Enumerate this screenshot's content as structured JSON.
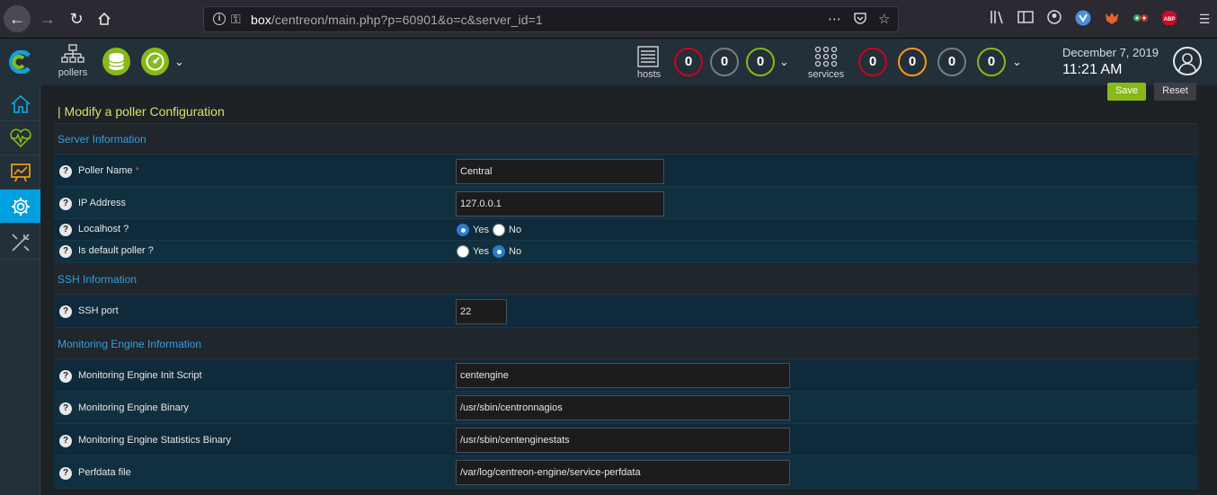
{
  "browser": {
    "url_host": "box",
    "url_path": "/centreon/main.php?p=60901&o=c&server_id=1"
  },
  "header": {
    "pollers_label": "pollers",
    "hosts_label": "hosts",
    "services_label": "services",
    "host_counts": [
      "0",
      "0",
      "0"
    ],
    "service_counts": [
      "0",
      "0",
      "0",
      "0"
    ],
    "date": "December 7, 2019",
    "time": "11:21 AM",
    "colors": {
      "critical": "#d0021b",
      "unreachable": "#7c7c7c",
      "ok": "#88b917",
      "warning": "#ff9913",
      "accent": "#009fdf"
    }
  },
  "toolbar": {
    "save_label": "Save",
    "reset_label": "Reset"
  },
  "page": {
    "title": "| Modify a poller Configuration"
  },
  "sections": {
    "server": "Server Information",
    "ssh": "SSH Information",
    "engine": "Monitoring Engine Information"
  },
  "fields": {
    "poller_name": {
      "label": "Poller Name",
      "required": "*",
      "value": "Central"
    },
    "ip_address": {
      "label": "IP Address",
      "value": "127.0.0.1"
    },
    "localhost": {
      "label": "Localhost ?",
      "yes": "Yes",
      "no": "No",
      "selected": "Yes"
    },
    "default_poller": {
      "label": "Is default poller ?",
      "yes": "Yes",
      "no": "No",
      "selected": "No"
    },
    "ssh_port": {
      "label": "SSH port",
      "value": "22"
    },
    "init_script": {
      "label": "Monitoring Engine Init Script",
      "value": "centengine"
    },
    "binary": {
      "label": "Monitoring Engine Binary",
      "value": "/usr/sbin/centronnagios"
    },
    "stats_binary": {
      "label": "Monitoring Engine Statistics Binary",
      "value": "/usr/sbin/centenginestats"
    },
    "perfdata": {
      "label": "Perfdata file",
      "value": "/var/log/centreon-engine/service-perfdata"
    }
  },
  "icons": {
    "help": "?"
  }
}
